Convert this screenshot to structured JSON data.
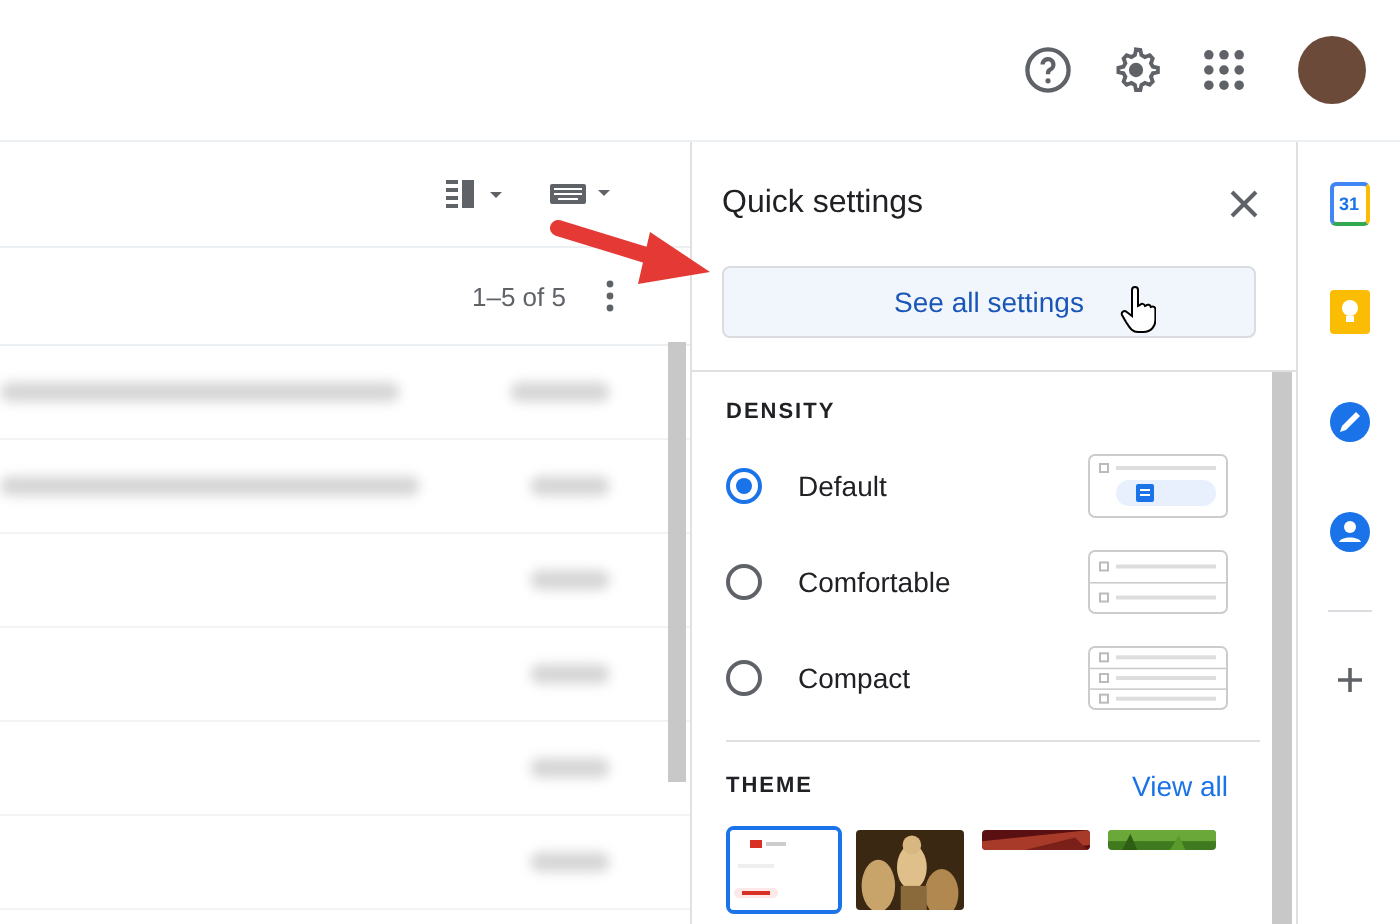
{
  "mail": {
    "pagination": "1–5 of 5"
  },
  "quick_settings": {
    "title": "Quick settings",
    "button": "See all settings",
    "density": {
      "heading": "DENSITY",
      "options": [
        {
          "label": "Default",
          "selected": true
        },
        {
          "label": "Comfortable",
          "selected": false
        },
        {
          "label": "Compact",
          "selected": false
        }
      ]
    },
    "theme": {
      "heading": "THEME",
      "link": "View all",
      "thumbnails": [
        {
          "kind": "default",
          "selected": true
        },
        {
          "kind": "picture",
          "selected": false
        },
        {
          "kind": "picture",
          "selected": false
        },
        {
          "kind": "picture",
          "selected": false
        }
      ]
    }
  },
  "side_rail": {
    "calendar_day": "31"
  }
}
